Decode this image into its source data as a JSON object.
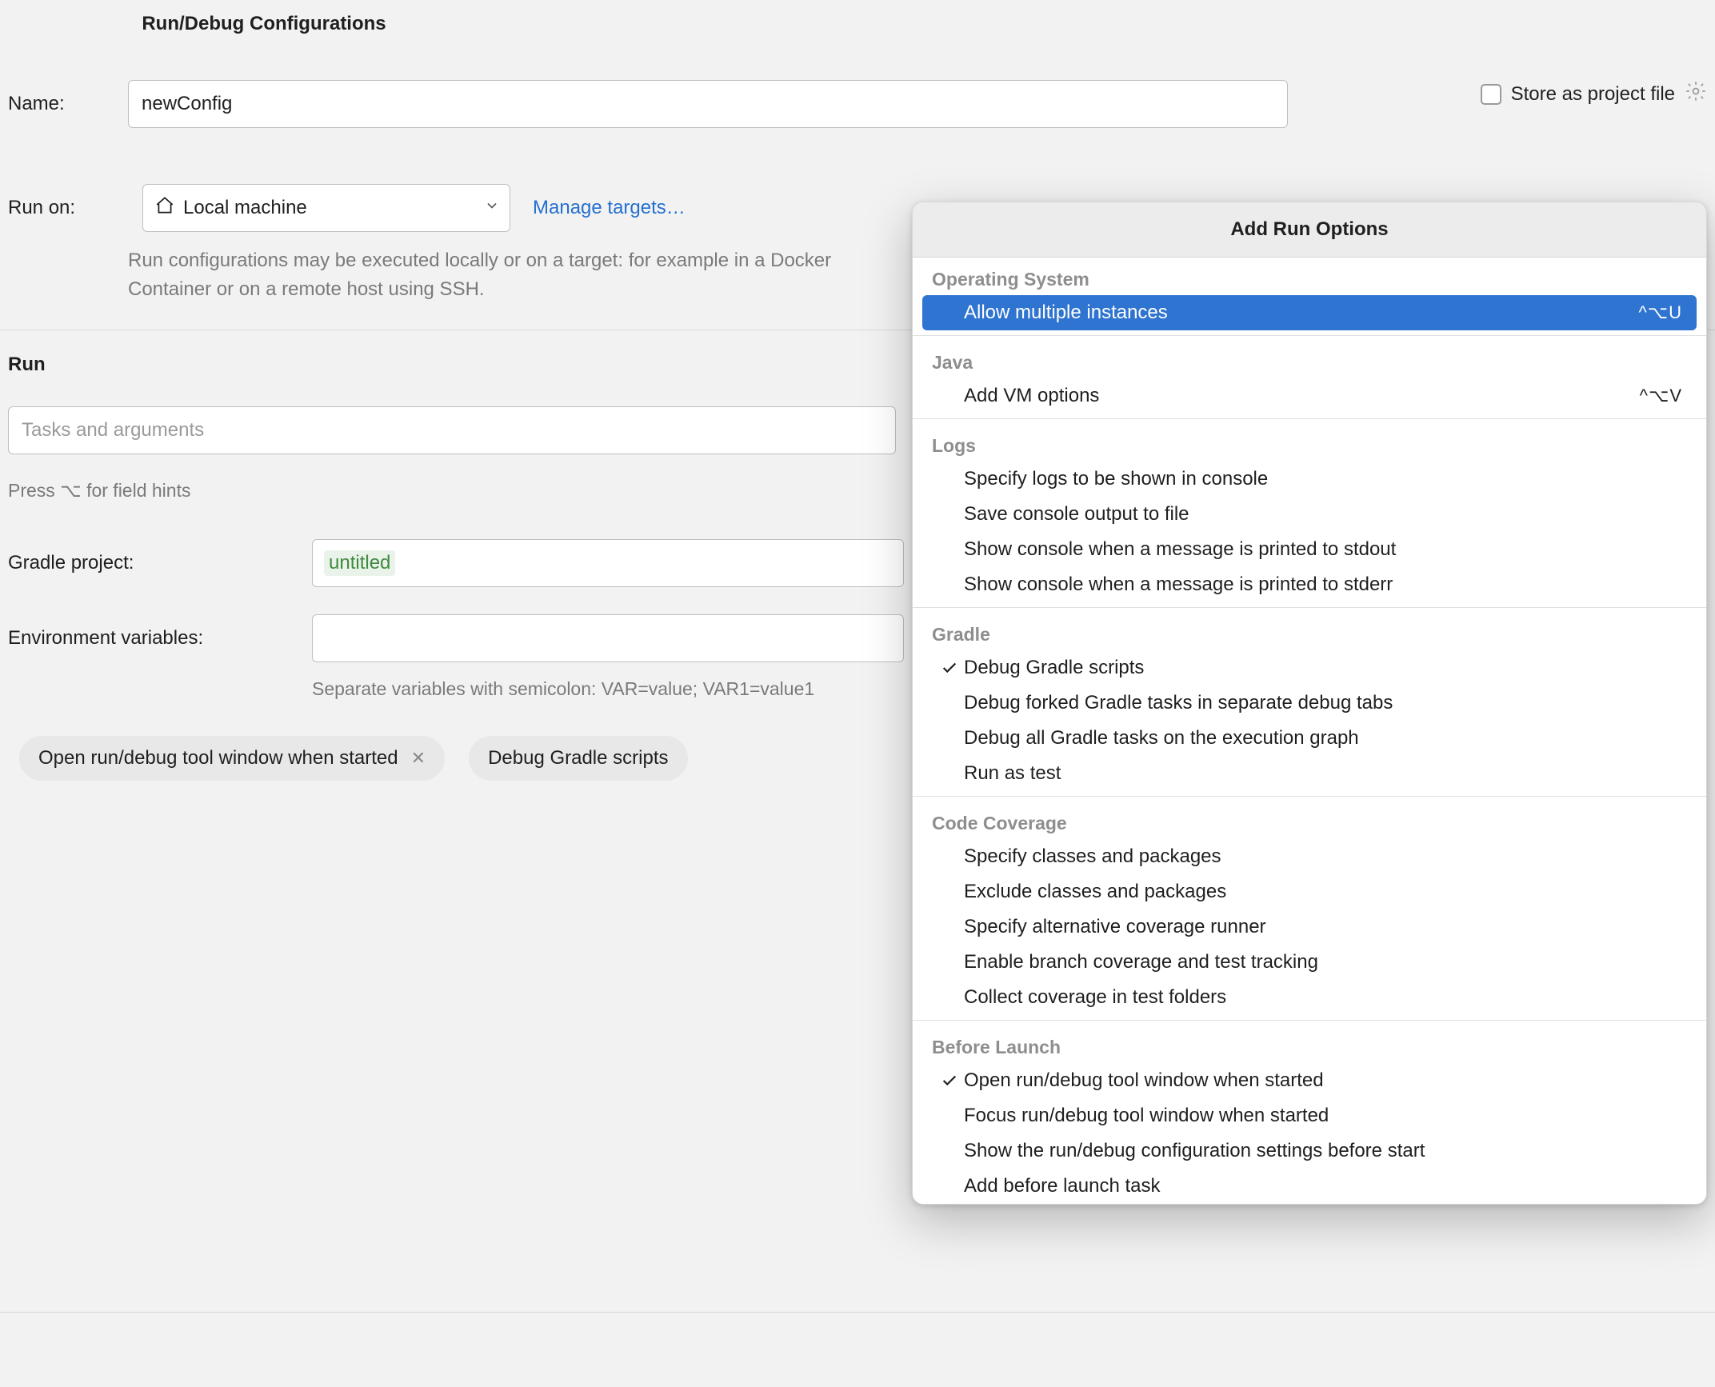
{
  "dialog_title": "Run/Debug Configurations",
  "name_label": "Name:",
  "name_value": "newConfig",
  "store_label": "Store as project file",
  "runon_label": "Run on:",
  "runon_value": "Local machine",
  "manage_targets": "Manage targets…",
  "runon_hint": "Run configurations may be executed locally or on a target: for example in a Docker Container or on a remote host using SSH.",
  "run_heading": "Run",
  "tasks_placeholder": "Tasks and arguments",
  "field_hints": "Press ⌥ for field hints",
  "gradle_project_label": "Gradle project:",
  "gradle_project_value": "untitled",
  "env_label": "Environment variables:",
  "env_hint": "Separate variables with semicolon: VAR=value; VAR1=value1",
  "chips": {
    "open_tool_window": "Open run/debug tool window when started",
    "debug_gradle_scripts": "Debug Gradle scripts"
  },
  "popup": {
    "title": "Add Run Options",
    "groups": [
      {
        "label": "Operating System",
        "items": [
          {
            "label": "Allow multiple instances",
            "shortcut": "^⌥U",
            "selected": true
          }
        ]
      },
      {
        "label": "Java",
        "items": [
          {
            "label": "Add VM options",
            "shortcut": "^⌥V"
          }
        ]
      },
      {
        "label": "Logs",
        "items": [
          {
            "label": "Specify logs to be shown in console"
          },
          {
            "label": "Save console output to file"
          },
          {
            "label": "Show console when a message is printed to stdout"
          },
          {
            "label": "Show console when a message is printed to stderr"
          }
        ]
      },
      {
        "label": "Gradle",
        "items": [
          {
            "label": "Debug Gradle scripts",
            "checked": true
          },
          {
            "label": "Debug forked Gradle tasks in separate debug tabs"
          },
          {
            "label": "Debug all Gradle tasks on the execution graph"
          },
          {
            "label": "Run as test"
          }
        ]
      },
      {
        "label": "Code Coverage",
        "items": [
          {
            "label": "Specify classes and packages"
          },
          {
            "label": "Exclude classes and packages"
          },
          {
            "label": "Specify alternative coverage runner"
          },
          {
            "label": "Enable branch coverage and test tracking"
          },
          {
            "label": "Collect coverage in test folders"
          }
        ]
      },
      {
        "label": "Before Launch",
        "items": [
          {
            "label": "Open run/debug tool window when started",
            "checked": true
          },
          {
            "label": "Focus run/debug tool window when started"
          },
          {
            "label": "Show the run/debug configuration settings before start"
          },
          {
            "label": "Add before launch task"
          }
        ]
      }
    ]
  }
}
